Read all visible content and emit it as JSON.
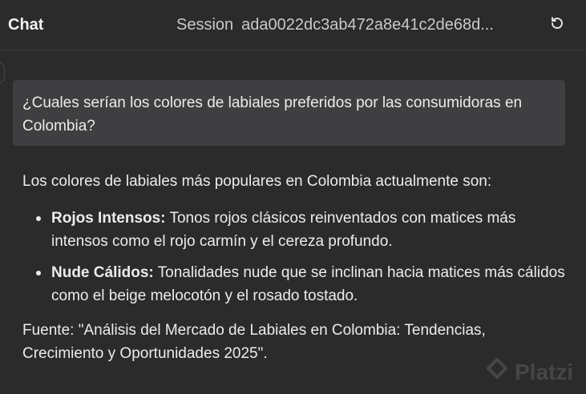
{
  "header": {
    "title": "Chat",
    "session_label": "Session",
    "session_id": "ada0022dc3ab472a8e41c2de68d..."
  },
  "conversation": {
    "user_message": "¿Cuales serían los colores de labiales preferidos por las consumidoras en Colombia?",
    "assistant": {
      "intro": "Los colores de labiales más populares en Colombia actualmente son:",
      "items": [
        {
          "title": "Rojos Intensos:",
          "text": " Tonos rojos clásicos reinventados con matices más intensos como el rojo carmín y el cereza profundo."
        },
        {
          "title": "Nude Cálidos:",
          "text": " Tonalidades nude que se inclinan hacia matices más cálidos como el beige melocotón y el rosado tostado."
        }
      ],
      "source": "Fuente: \"Análisis del Mercado de Labiales en Colombia: Tendencias, Crecimiento y Oportunidades 2025\"."
    }
  },
  "watermark": {
    "text": "Platzi"
  },
  "icons": {
    "reset": "reset-icon",
    "logo": "platzi-logo-icon"
  },
  "colors": {
    "background": "#2b2b2b",
    "user_bubble": "#3f3f41",
    "text": "#ececec"
  }
}
